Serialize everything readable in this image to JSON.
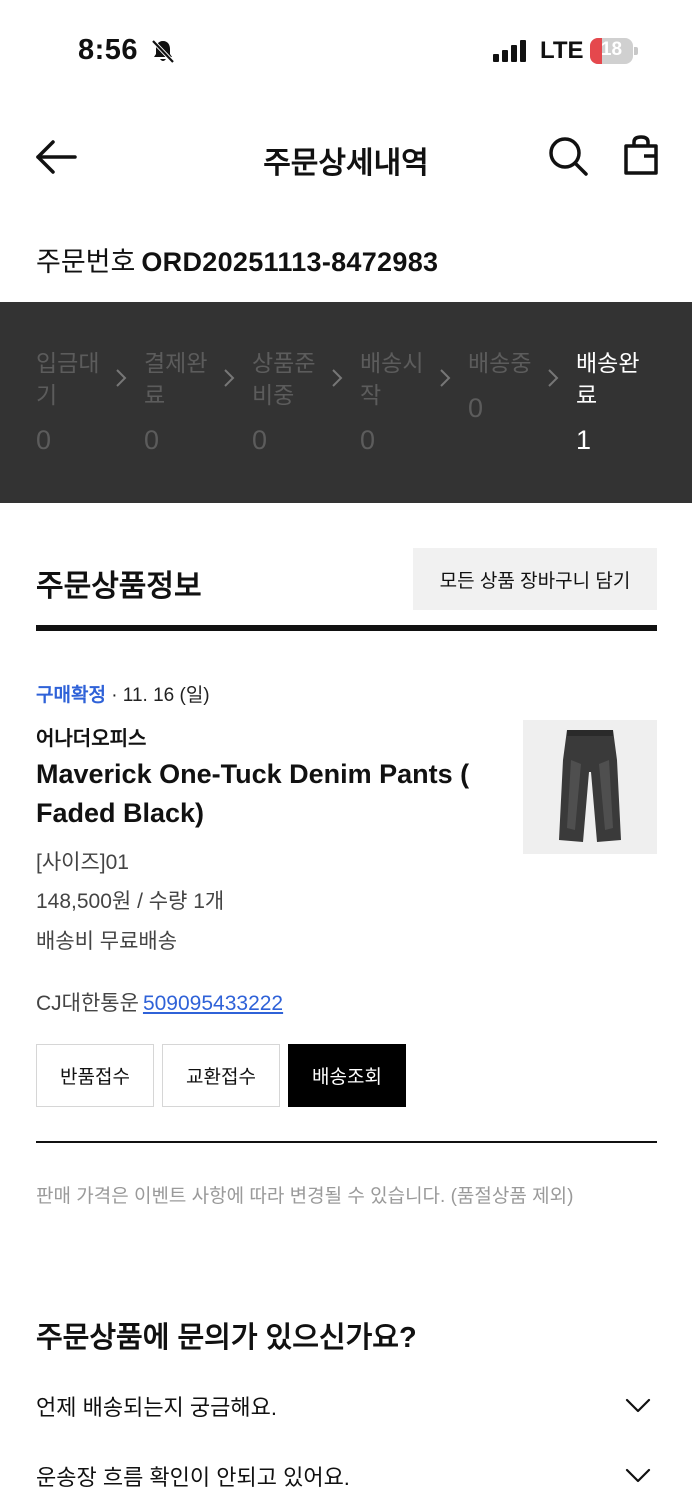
{
  "status_bar": {
    "time": "8:56",
    "network": "LTE",
    "battery": "18",
    "icons": [
      "bell-muted-icon",
      "signal-icon",
      "battery-icon"
    ]
  },
  "header": {
    "title": "주문상세내역",
    "icons": [
      "back-arrow-icon",
      "search-icon",
      "shopping-bag-icon"
    ]
  },
  "order": {
    "label": "주문번호",
    "number": "ORD20251113-8472983"
  },
  "steps": [
    {
      "label": "입금대기",
      "count": "0",
      "active": false
    },
    {
      "label": "결제완료",
      "count": "0",
      "active": false
    },
    {
      "label": "상품준비중",
      "count": "0",
      "active": false
    },
    {
      "label": "배송시작",
      "count": "0",
      "active": false
    },
    {
      "label": "배송중",
      "count": "0",
      "active": false
    },
    {
      "label": "배송완료",
      "count": "1",
      "active": true
    }
  ],
  "section": {
    "title": "주문상품정보",
    "cart_all_label": "모든 상품 장바구니 담기"
  },
  "item": {
    "status": "구매확정",
    "date": " · 11. 16 (일)",
    "brand": "어나더오피스",
    "name": "Maverick One-Tuck Denim Pants ( Faded Black)",
    "option": "[사이즈]01",
    "price_qty": "148,500원 / 수량 1개",
    "shipping": "배송비 무료배송",
    "courier": "CJ대한통운",
    "tracking": "509095433222",
    "buttons": {
      "return": "반품접수",
      "exchange": "교환접수",
      "track": "배송조회"
    }
  },
  "notice": "판매 가격은 이벤트 사항에 따라 변경될 수 있습니다. (품절상품 제외)",
  "inquiry": {
    "title": "주문상품에 문의가 있으신가요?",
    "faqs": [
      "언제 배송되는지 궁금해요.",
      "운송장 흐름 확인이 안되고 있어요."
    ]
  },
  "colors": {
    "accent_blue": "#2f62d8",
    "step_band": "#333333",
    "step_inactive": "#5c5c5c"
  }
}
